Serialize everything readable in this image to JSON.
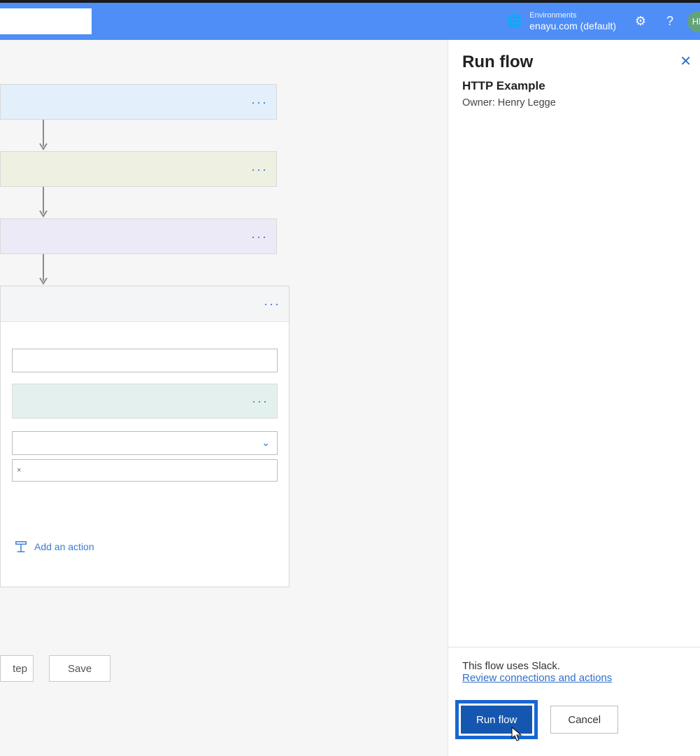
{
  "header": {
    "env_label": "Environments",
    "env_value": "enayu.com (default)",
    "avatar_initials": "HL"
  },
  "canvas": {
    "add_action_label": "Add an action",
    "chip_close": "×",
    "footer": {
      "step_label": "tep",
      "save_label": "Save"
    }
  },
  "panel": {
    "title": "Run flow",
    "flow_name": "HTTP Example",
    "owner_line": "Owner: Henry Legge",
    "uses_line": "This flow uses Slack.",
    "review_link": "Review connections and actions",
    "run_label": "Run flow",
    "cancel_label": "Cancel"
  }
}
